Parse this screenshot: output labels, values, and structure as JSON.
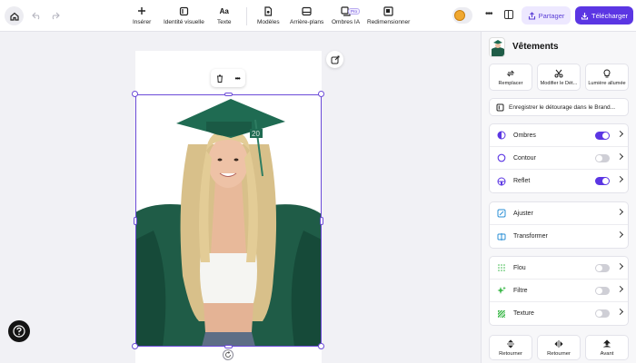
{
  "topbar": {
    "tools": [
      {
        "label": "Insérer",
        "icon": "plus-icon"
      },
      {
        "label": "Identité visuelle",
        "icon": "brand-icon"
      },
      {
        "label": "Texte",
        "icon": "text-icon"
      },
      {
        "label": "Modèles",
        "icon": "templates-icon"
      },
      {
        "label": "Arrière-plans",
        "icon": "background-icon"
      },
      {
        "label": "Ombres IA",
        "icon": "ai-shadows-icon"
      },
      {
        "label": "Redimensionner",
        "icon": "resize-icon"
      }
    ],
    "pro_badge": "Pro",
    "share_label": "Partager",
    "download_label": "Télécharger",
    "colors": {
      "accent": "#5b36e3",
      "accent_light": "#ede8ff"
    }
  },
  "canvas": {
    "cap_number": "20",
    "help_icon": "question-icon"
  },
  "panel": {
    "title": "Vêtements",
    "actions": [
      {
        "label": "Remplacer",
        "icon": "replace-icon"
      },
      {
        "label": "Modifier le Dét...",
        "icon": "scissors-icon"
      },
      {
        "label": "Lumière allumée",
        "icon": "bulb-icon"
      }
    ],
    "save_cutout": "Enregistrer le détourage dans le Brand...",
    "effects": [
      {
        "label": "Ombres",
        "on": true
      },
      {
        "label": "Contour",
        "on": false
      },
      {
        "label": "Reflet",
        "on": true
      }
    ],
    "adjust": [
      {
        "label": "Ajuster"
      },
      {
        "label": "Transformer"
      }
    ],
    "filters": [
      {
        "label": "Flou",
        "on": false
      },
      {
        "label": "Filtre",
        "on": false
      },
      {
        "label": "Texture",
        "on": false
      }
    ],
    "bottom": [
      {
        "label": "Retourner",
        "icon": "flip-vertical-icon"
      },
      {
        "label": "Retourner",
        "icon": "flip-horizontal-icon"
      },
      {
        "label": "Avant",
        "icon": "bring-forward-icon"
      }
    ]
  }
}
